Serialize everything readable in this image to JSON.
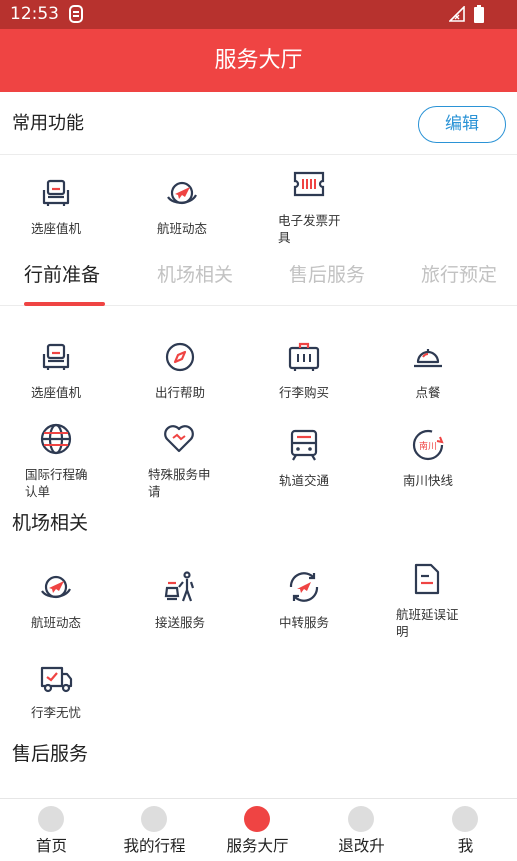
{
  "status_bar": {
    "time": "12:53"
  },
  "header": {
    "title": "服务大厅"
  },
  "common": {
    "title": "常用功能",
    "edit_label": "编辑",
    "items": [
      {
        "label": "选座值机",
        "icon": "seat-icon"
      },
      {
        "label": "航班动态",
        "icon": "flight-status-icon"
      },
      {
        "label": "电子发票开具",
        "icon": "invoice-icon"
      }
    ]
  },
  "tabs": [
    {
      "label": "行前准备",
      "active": true
    },
    {
      "label": "机场相关"
    },
    {
      "label": "售后服务"
    },
    {
      "label": "旅行预定"
    }
  ],
  "pre_trip": {
    "items": [
      {
        "label": "选座值机",
        "icon": "seat-icon"
      },
      {
        "label": "出行帮助",
        "icon": "compass-icon"
      },
      {
        "label": "行李购买",
        "icon": "luggage-icon"
      },
      {
        "label": "点餐",
        "icon": "food-cloche-icon"
      },
      {
        "label": "国际行程确认单",
        "icon": "globe-icon"
      },
      {
        "label": "特殊服务申请",
        "icon": "heart-icon"
      },
      {
        "label": "轨道交通",
        "icon": "train-icon"
      },
      {
        "label": "南川快线",
        "icon": "nanchuan-express-icon",
        "badge": "南川"
      }
    ]
  },
  "airport": {
    "title": "机场相关",
    "items": [
      {
        "label": "航班动态",
        "icon": "flight-status-icon"
      },
      {
        "label": "接送服务",
        "icon": "pickup-icon"
      },
      {
        "label": "中转服务",
        "icon": "transfer-icon"
      },
      {
        "label": "航班延误证明",
        "icon": "document-icon"
      },
      {
        "label": "行李无忧",
        "icon": "baggage-truck-icon"
      }
    ]
  },
  "after_sales": {
    "title": "售后服务"
  },
  "bottom_nav": [
    {
      "label": "首页"
    },
    {
      "label": "我的行程"
    },
    {
      "label": "服务大厅",
      "active": true
    },
    {
      "label": "退改升"
    },
    {
      "label": "我"
    }
  ],
  "colors": {
    "brand_red": "#ef4443",
    "status_bar": "#b7322e",
    "link_blue": "#2b93d6",
    "icon_navy": "#2e3a52"
  }
}
